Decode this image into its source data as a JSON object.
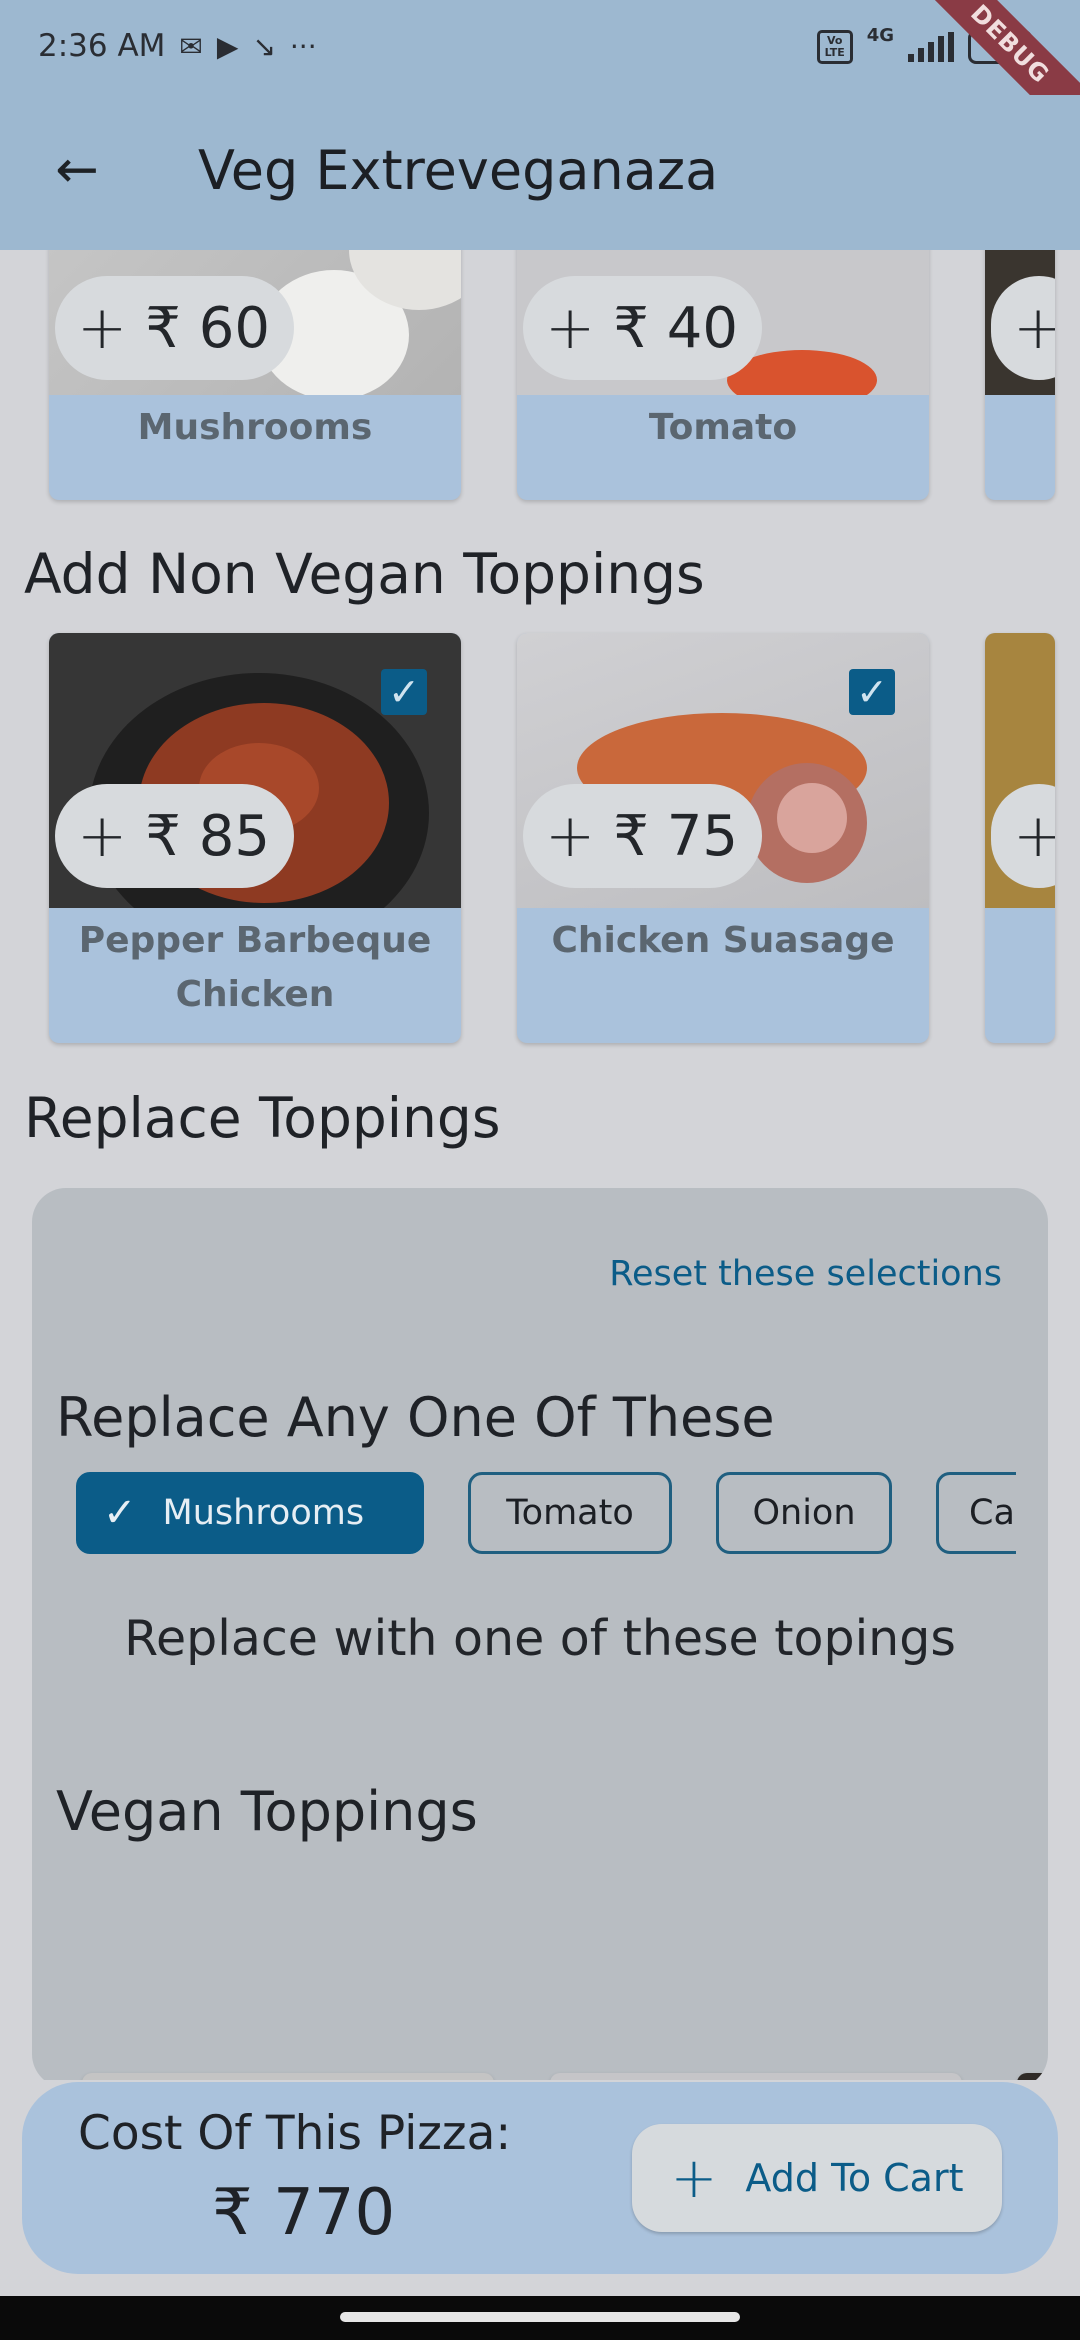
{
  "status_bar": {
    "time": "2:36 AM",
    "volte": "Vo LTE",
    "network": "4G",
    "battery": "46",
    "debug_banner": "DEBUG"
  },
  "app_bar": {
    "title": "Veg Extreveganaza"
  },
  "vegan_toppings_row": {
    "items": [
      {
        "name": "Mushrooms",
        "price": "₹ 60"
      },
      {
        "name": "Tomato",
        "price": "₹ 40"
      }
    ]
  },
  "non_vegan_section": {
    "title": "Add Non Vegan Toppings",
    "items": [
      {
        "name": "Pepper Barbeque Chicken",
        "price": "₹ 85",
        "checked": true
      },
      {
        "name": "Chicken Suasage",
        "price": "₹ 75",
        "checked": true
      }
    ]
  },
  "replace_section": {
    "title": "Replace Toppings",
    "reset_label": "Reset these selections",
    "replace_any_heading": "Replace Any One Of These",
    "chips": [
      {
        "label": "Mushrooms",
        "selected": true
      },
      {
        "label": "Tomato",
        "selected": false
      },
      {
        "label": "Onion",
        "selected": false
      },
      {
        "label": "Cap",
        "selected": false
      }
    ],
    "replace_with_text": "Replace  with one of these topings",
    "vegan_heading": "Vegan Toppings",
    "options": [
      {
        "selected": false
      },
      {
        "selected": true
      }
    ]
  },
  "cart": {
    "cost_label": "Cost Of This Pizza:",
    "cost_value": "₹ 770",
    "add_label": "Add To Cart"
  }
}
